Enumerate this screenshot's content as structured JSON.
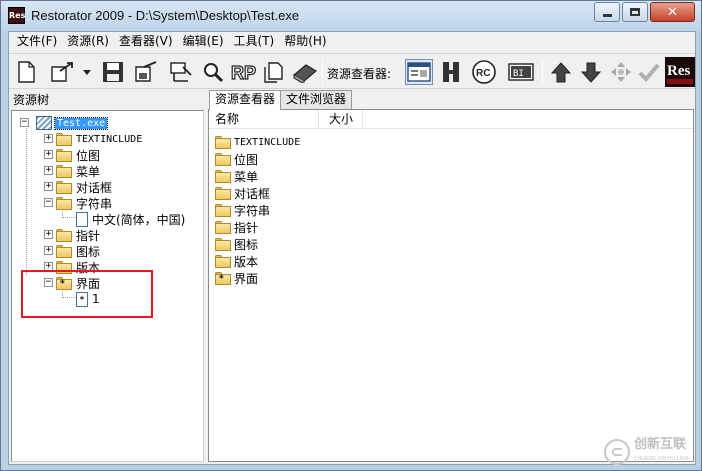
{
  "window": {
    "title": "Restorator 2009 - D:\\System\\Desktop\\Test.exe",
    "app_icon_text": "Res",
    "min_icon": "minimize-icon",
    "max_icon": "maximize-icon",
    "close_icon": "close-icon",
    "close_glyph": "✕"
  },
  "menu": [
    {
      "label": "文件(F)"
    },
    {
      "label": "资源(R)"
    },
    {
      "label": "查看器(V)"
    },
    {
      "label": "编辑(E)"
    },
    {
      "label": "工具(T)"
    },
    {
      "label": "帮助(H)"
    }
  ],
  "toolbar": {
    "viewer_label": "资源查看器:",
    "buttons": [
      "new-file-icon",
      "open-file-icon",
      "dropdown-arrow-icon",
      "save-icon",
      "save-as-icon",
      "extract-icon",
      "search-icon",
      "rp-icon",
      "copy-icon",
      "book-icon",
      "viewer-icon",
      "hex-icon",
      "rc-icon",
      "binary-icon",
      "arrow-up-icon",
      "arrow-down-icon",
      "navigate-icon",
      "check-icon",
      "res-logo"
    ],
    "rp_text": "RP",
    "rc_text": "RC",
    "bin_text": "BI",
    "res_logo_text": "Res"
  },
  "left_panel": {
    "header": "资源树",
    "tree": {
      "root": "Test.exe",
      "items": [
        {
          "label": "TEXTINCLUDE",
          "mono": true
        },
        {
          "label": "位图"
        },
        {
          "label": "菜单"
        },
        {
          "label": "对话框"
        },
        {
          "label": "字符串",
          "expanded": true,
          "children": [
            {
              "label": "中文(简体，中国)"
            }
          ]
        },
        {
          "label": "指针"
        },
        {
          "label": "图标"
        },
        {
          "label": "版本"
        },
        {
          "label": "界面",
          "expanded": true,
          "special": true,
          "children": [
            {
              "label": "1"
            }
          ]
        }
      ]
    }
  },
  "right_panel": {
    "tabs": [
      {
        "label": "资源查看器",
        "active": true
      },
      {
        "label": "文件浏览器",
        "active": false
      }
    ],
    "columns": [
      "名称",
      "大小"
    ],
    "rows": [
      {
        "name": "TEXTINCLUDE",
        "mono": true
      },
      {
        "name": "位图"
      },
      {
        "name": "菜单"
      },
      {
        "name": "对话框"
      },
      {
        "name": "字符串"
      },
      {
        "name": "指针"
      },
      {
        "name": "图标"
      },
      {
        "name": "版本"
      },
      {
        "name": "界面",
        "special": true
      }
    ]
  },
  "annotation": {
    "color": "#e8171c"
  },
  "watermark": {
    "text": "创新互联",
    "sub": "CHUANG XIN HU LIAN"
  },
  "colors": {
    "selection": "#3399ff",
    "titlebar": "#c4d6ea",
    "folder": "#f0c95c"
  }
}
